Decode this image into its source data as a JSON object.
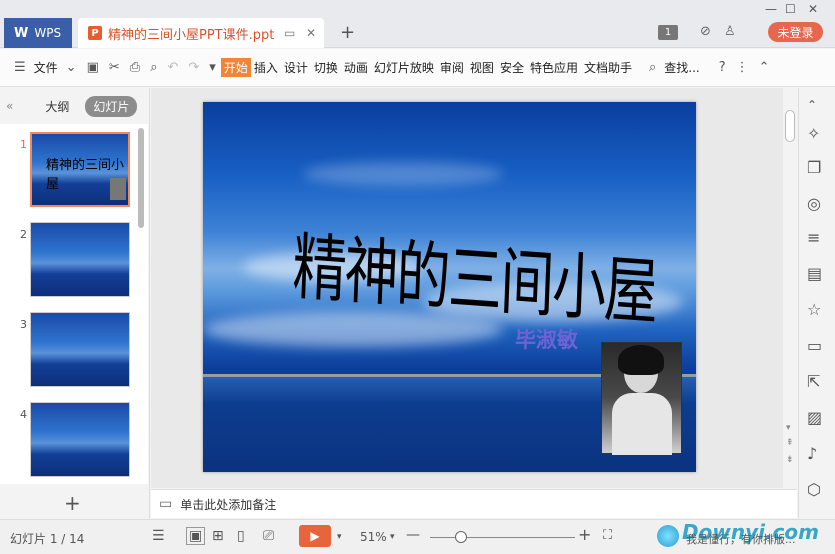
{
  "titlebar": {
    "app_tab": "WPS",
    "doc_tab_title": "精神的三间小屋PPT课件.ppt",
    "page_badge": "1",
    "login_label": "未登录"
  },
  "menubar": {
    "file_label": "文件",
    "tabs": [
      "开始",
      "插入",
      "设计",
      "切换",
      "动画",
      "幻灯片放映",
      "审阅",
      "视图",
      "安全",
      "特色应用",
      "文档助手"
    ],
    "find_label": "查找..."
  },
  "left_panel": {
    "tab_outline": "大纲",
    "tab_slides": "幻灯片",
    "slide_numbers": [
      "1",
      "2",
      "3",
      "4"
    ]
  },
  "slide": {
    "title": "精神的三间小屋",
    "author": "毕淑敏"
  },
  "notes": {
    "placeholder": "单击此处添加备注"
  },
  "statusbar": {
    "slide_counter": "幻灯片 1 / 14",
    "zoom": "51%",
    "watermark_brand": "Downyi.com",
    "watermark_sub": "我是懂行，有你排版..."
  },
  "colors": {
    "accent": "#e8643b",
    "wps_blue": "#3a5fa8"
  }
}
